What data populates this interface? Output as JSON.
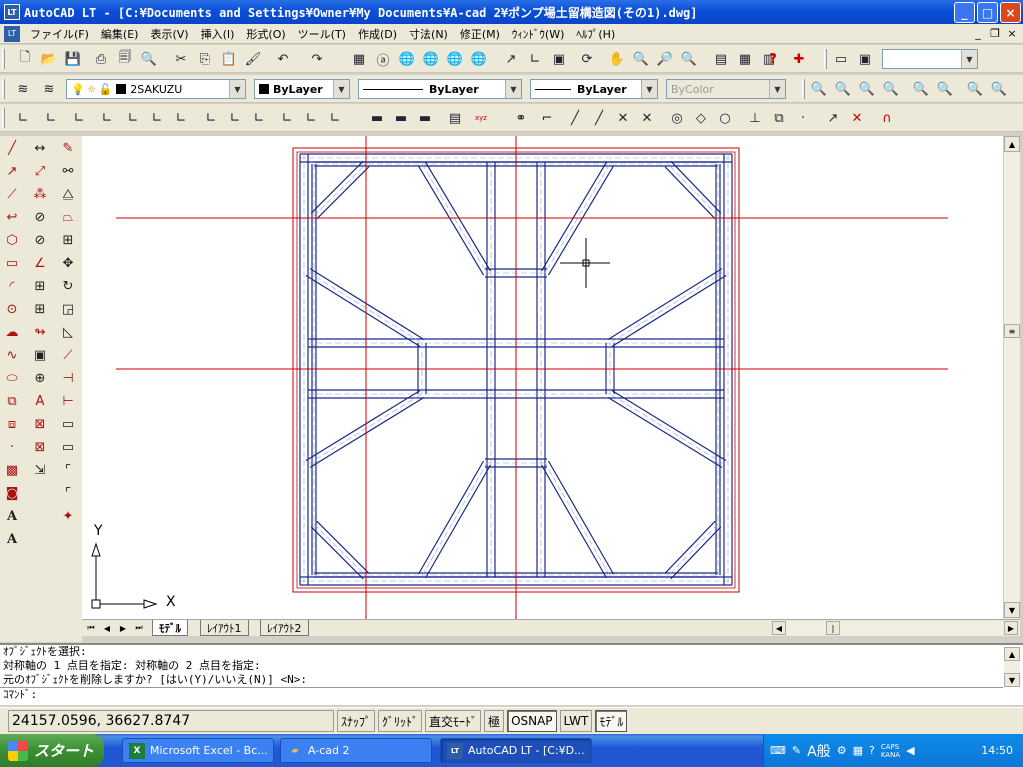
{
  "window": {
    "app_icon": "LT",
    "title": "AutoCAD LT - [C:¥Documents and Settings¥Owner¥My Documents¥A-cad 2¥ポンプ場土留構造図(その1).dwg]",
    "minimize": "_",
    "maximize": "□",
    "close": "×"
  },
  "menubar": {
    "items": [
      "ファイル(F)",
      "編集(E)",
      "表示(V)",
      "挿入(I)",
      "形式(O)",
      "ツール(T)",
      "作成(D)",
      "寸法(N)",
      "修正(M)",
      "ｳｨﾝﾄﾞｳ(W)",
      "ﾍﾙﾌﾟ(H)"
    ],
    "doc_min": "_",
    "doc_restore": "❐",
    "doc_close": "×"
  },
  "layers": {
    "current_layer": "2SAKUZU",
    "color": "ByLayer",
    "linetype": "ByLayer",
    "lineweight": "ByLayer",
    "plotstyle": "ByColor"
  },
  "canvas": {
    "ucs_x": "X",
    "ucs_y": "Y"
  },
  "layout_tabs": [
    "ﾓﾃﾞﾙ",
    "ﾚｲｱｳﾄ1",
    "ﾚｲｱｳﾄ2"
  ],
  "command": {
    "history": [
      "ｵﾌﾞｼﾞｪｸﾄを選択:",
      "対称軸の 1 点目を指定: 対称軸の 2 点目を指定:",
      "元のｵﾌﾞｼﾞｪｸﾄを削除しますか? [はい(Y)/いいえ(N)] <N>:"
    ],
    "prompt": "ｺﾏﾝﾄﾞ:"
  },
  "status": {
    "coordinates": "24157.0596, 36627.8747",
    "buttons": [
      {
        "label": "ｽﾅｯﾌﾟ",
        "on": false
      },
      {
        "label": "ｸﾞﾘｯﾄﾞ",
        "on": false
      },
      {
        "label": "直交ﾓｰﾄﾞ",
        "on": false
      },
      {
        "label": "極",
        "on": false
      },
      {
        "label": "OSNAP",
        "on": true
      },
      {
        "label": "LWT",
        "on": false
      },
      {
        "label": "ﾓﾃﾞﾙ",
        "on": true
      }
    ]
  },
  "taskbar": {
    "start": "スタート",
    "tasks": [
      {
        "label": "Microsoft Excel - Bc...",
        "icon": "X",
        "icon_color": "#1d7d3a"
      },
      {
        "label": "A-cad 2",
        "icon": "▰",
        "icon_color": "#e8c040"
      },
      {
        "label": "AutoCAD LT - [C:¥D...",
        "icon": "LT",
        "icon_color": "#2d5ea8"
      }
    ],
    "ime": "A般",
    "caps": "CAPS",
    "kana": "KANA",
    "clock": "14:50"
  },
  "colors": {
    "titlebar": "#0a4fd8",
    "drawing_line": "#1a2a8a",
    "centerline": "#cc0000",
    "frame": "#cc0000"
  }
}
